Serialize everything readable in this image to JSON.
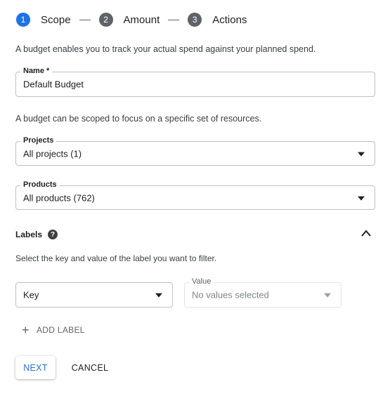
{
  "stepper": {
    "steps": [
      {
        "number": "1",
        "label": "Scope",
        "state": "active"
      },
      {
        "number": "2",
        "label": "Amount",
        "state": "inactive"
      },
      {
        "number": "3",
        "label": "Actions",
        "state": "inactive"
      }
    ]
  },
  "intro_text": "A budget enables you to track your actual spend against your planned spend.",
  "name_field": {
    "label": "Name *",
    "value": "Default Budget"
  },
  "scope_text": "A budget can be scoped to focus on a specific set of resources.",
  "projects_field": {
    "label": "Projects",
    "value": "All projects (1)"
  },
  "products_field": {
    "label": "Products",
    "value": "All products (762)"
  },
  "labels_section": {
    "title": "Labels",
    "help_glyph": "?",
    "description": "Select the key and value of the label you want to filter.",
    "key_field": {
      "value": "Key"
    },
    "value_field": {
      "label": "Value",
      "value": "No values selected"
    },
    "add_label": {
      "icon": "+",
      "text": "ADD LABEL"
    }
  },
  "buttons": {
    "next": "NEXT",
    "cancel": "CANCEL"
  },
  "colors": {
    "accent": "#1a73e8",
    "inactive_step": "#5f6368",
    "border": "#bdc1c6"
  }
}
